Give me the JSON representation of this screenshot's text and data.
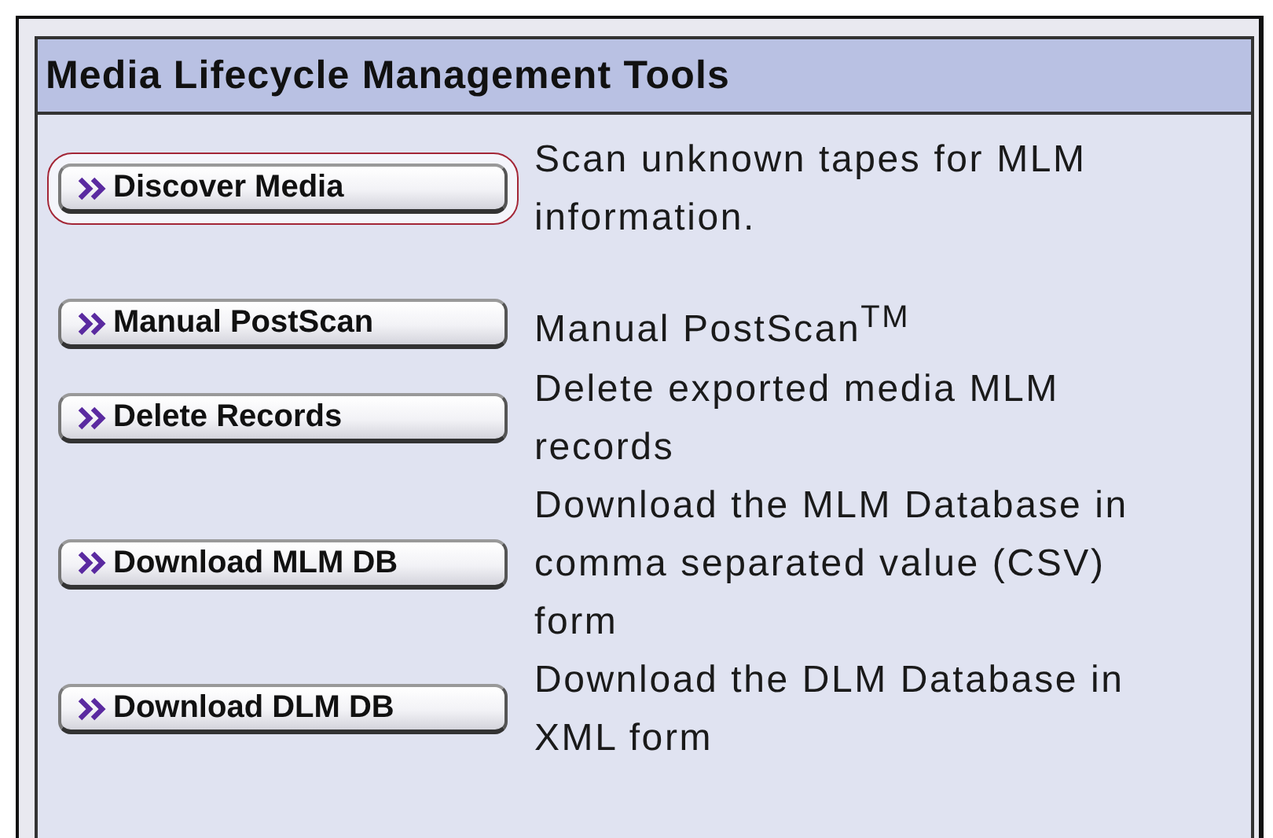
{
  "panel": {
    "title": "Media Lifecycle Management Tools"
  },
  "tools": [
    {
      "button": "Discover Media",
      "description": "Scan unknown tapes for MLM information.",
      "highlighted": true
    },
    {
      "button": "Manual PostScan",
      "description": "Manual PostScan$^{TM}$",
      "highlighted": false
    },
    {
      "button": "Delete Records",
      "description": "Delete exported media MLM records",
      "highlighted": false
    },
    {
      "button": "Download MLM DB",
      "description": "Download the MLM Database in comma separated value (CSV) form",
      "highlighted": false
    },
    {
      "button": "Download DLM DB",
      "description": "Download the DLM Database in XML form",
      "highlighted": false
    }
  ]
}
